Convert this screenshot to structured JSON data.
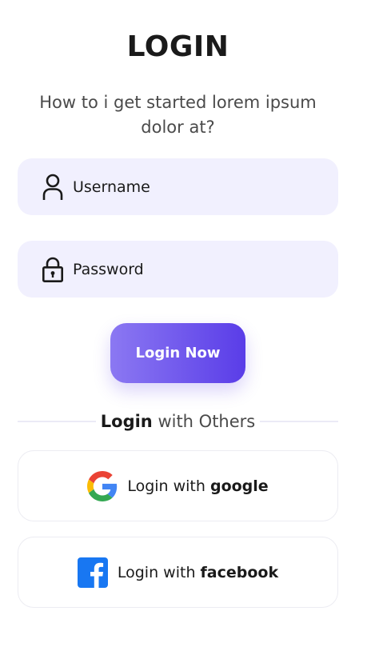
{
  "header": {
    "title": "LOGIN",
    "subtitle": "How to i get started lorem ipsum dolor at?"
  },
  "form": {
    "username_placeholder": "Username",
    "password_placeholder": "Password",
    "submit_label": "Login Now"
  },
  "divider": {
    "bold": "Login",
    "rest": " with Others"
  },
  "social": {
    "google": {
      "prefix": "Login with ",
      "brand": "google"
    },
    "facebook": {
      "prefix": "Login with ",
      "brand": "facebook"
    }
  },
  "icons": {
    "username": "user-icon",
    "password": "lock-icon",
    "google": "google-logo-icon",
    "facebook": "facebook-logo-icon"
  },
  "colors": {
    "field_background": "#f1f0fe",
    "button_gradient_start": "#8b78f2",
    "button_gradient_end": "#5a3de8",
    "facebook_blue": "#1877f2",
    "google_blue": "#4285F4",
    "google_red": "#EA4335",
    "google_yellow": "#FBBC05",
    "google_green": "#34A853"
  }
}
